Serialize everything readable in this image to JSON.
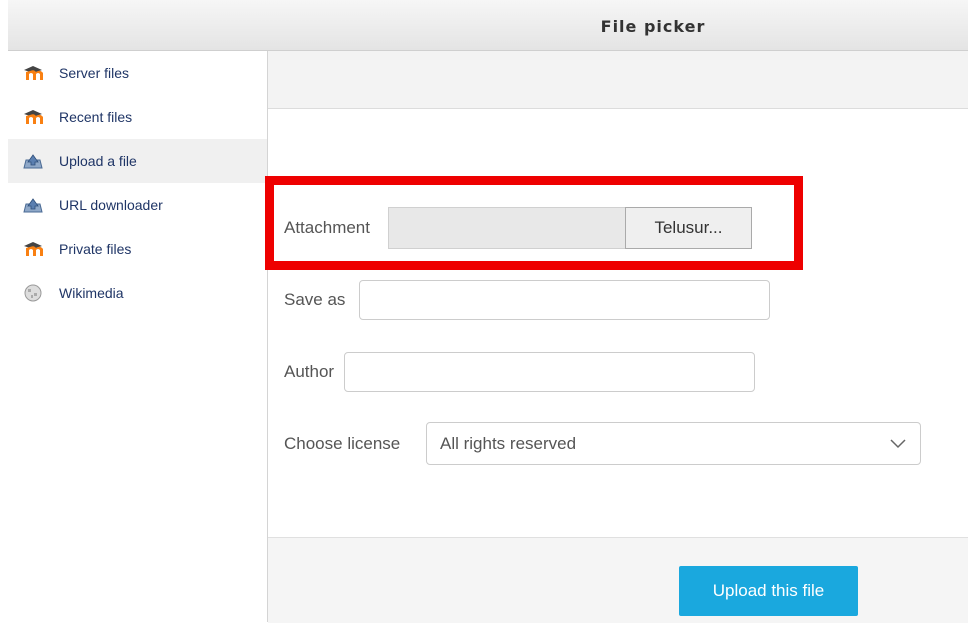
{
  "window": {
    "title": "File picker"
  },
  "sidebar": {
    "items": [
      {
        "label": "Server files",
        "icon": "moodle-icon"
      },
      {
        "label": "Recent files",
        "icon": "moodle-icon"
      },
      {
        "label": "Upload a file",
        "icon": "upload-icon",
        "active": true
      },
      {
        "label": "URL downloader",
        "icon": "upload-icon"
      },
      {
        "label": "Private files",
        "icon": "moodle-icon"
      },
      {
        "label": "Wikimedia",
        "icon": "wikimedia-globe-icon"
      }
    ]
  },
  "form": {
    "attachment_label": "Attachment",
    "browse_label": "Telusur...",
    "save_as_label": "Save as",
    "save_as_value": "",
    "author_label": "Author",
    "author_value": "",
    "license_label": "Choose license",
    "license_value": "All rights reserved"
  },
  "footer": {
    "upload_label": "Upload this file"
  },
  "colors": {
    "accent": "#1aa8de",
    "highlight": "#ee0000",
    "link": "#1f3566"
  }
}
